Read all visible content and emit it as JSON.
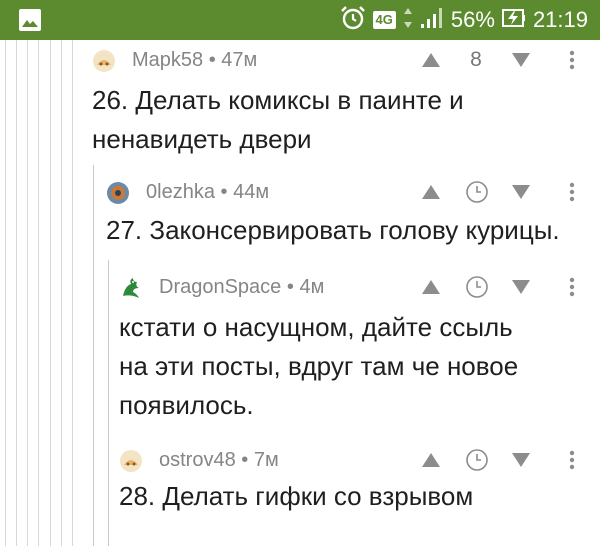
{
  "status_bar": {
    "network": "4G",
    "battery": "56%",
    "time": "21:19",
    "icons": [
      "image-icon",
      "alarm-icon",
      "data-arrows-icon",
      "signal-icon",
      "battery-charging-icon"
    ]
  },
  "comments": [
    {
      "author": "Мapk58",
      "time": "47м",
      "rating": "8",
      "lines": [
        "26. Делать комиксы в паинте и",
        "ненавидеть двери"
      ]
    },
    {
      "author": "0lezhka",
      "time": "44м",
      "lines": [
        "27. Законсервировать голову курицы."
      ]
    },
    {
      "author": "DragonSpace",
      "time": "4м",
      "lines": [
        "кстати о насущном, дайте ссыль",
        "на эти посты, вдруг там че новое",
        "появилось."
      ]
    },
    {
      "author": "ostrov48",
      "time": "7м",
      "lines": [
        "28. Делать гифки со взрывом"
      ]
    }
  ],
  "separator": "•",
  "colors": {
    "status_bar": "#5c8a2e",
    "text": "#1f1f1f",
    "meta": "#858585",
    "icon": "#8c8c8c"
  }
}
